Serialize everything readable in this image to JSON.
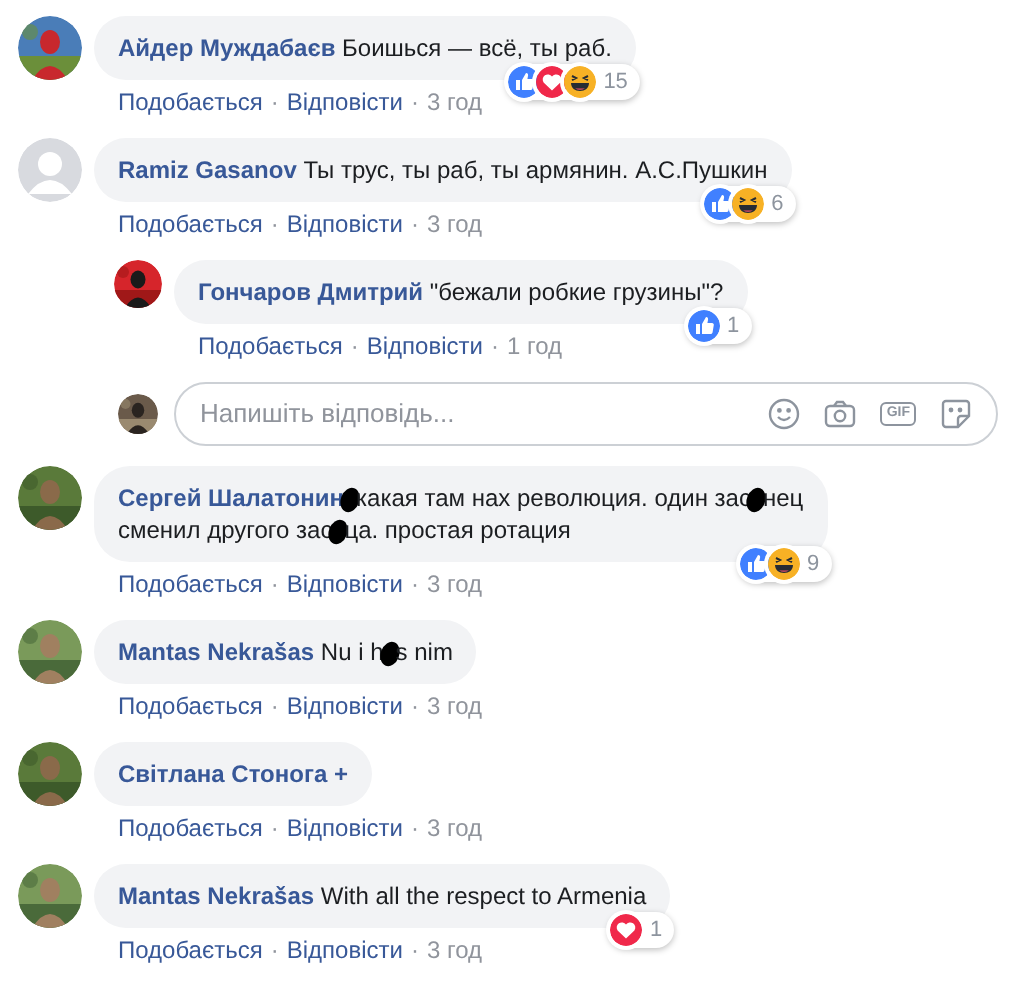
{
  "comments": [
    {
      "avatar": {
        "kind": "sos"
      },
      "name": "Айдер Муждабаєв",
      "parts": [
        {
          "kind": "text",
          "text": "Боишься — всё, ты раб."
        }
      ],
      "reactions": [
        {
          "kind": "like"
        },
        {
          "kind": "love"
        },
        {
          "kind": "haha"
        }
      ],
      "count": "15",
      "actions": [
        {
          "kind": "link",
          "text": "Подобається"
        },
        {
          "kind": "dot",
          "text": "·"
        },
        {
          "kind": "link",
          "text": "Відповісти"
        },
        {
          "kind": "dot",
          "text": "·"
        },
        {
          "kind": "time",
          "text": "3 год"
        }
      ]
    },
    {
      "avatar": {
        "kind": "default"
      },
      "name": "Ramiz Gasanov",
      "parts": [
        {
          "kind": "text",
          "text": "Ты трус, ты раб, ты армянин. А.С.Пушкин"
        }
      ],
      "reactions": [
        {
          "kind": "like"
        },
        {
          "kind": "haha"
        }
      ],
      "count": "6",
      "actions": [
        {
          "kind": "link",
          "text": "Подобається"
        },
        {
          "kind": "dot",
          "text": "·"
        },
        {
          "kind": "link",
          "text": "Відповісти"
        },
        {
          "kind": "dot",
          "text": "·"
        },
        {
          "kind": "time",
          "text": "3 год"
        }
      ],
      "children": [
        {
          "avatar": {
            "kind": "red"
          },
          "name": "Гончаров Дмитрий",
          "parts": [
            {
              "kind": "text",
              "text": "\"бежали робкие грузины\"?"
            }
          ],
          "reactions": [
            {
              "kind": "like"
            }
          ],
          "count": "1",
          "actions": [
            {
              "kind": "link",
              "text": "Подобається"
            },
            {
              "kind": "dot",
              "text": "·"
            },
            {
              "kind": "link",
              "text": "Відповісти"
            },
            {
              "kind": "dot",
              "text": "·"
            },
            {
              "kind": "time",
              "text": "1 год"
            }
          ]
        }
      ],
      "reply_box": {
        "avatar": {
          "kind": "dark"
        },
        "placeholder": "Напишіть відповідь...",
        "gif_label": "GIF"
      }
    },
    {
      "avatar": {
        "kind": "forest"
      },
      "name": "Сергей Шалатонин",
      "parts": [
        {
          "kind": "blot"
        },
        {
          "kind": "text",
          "text": "какая там нах революция. один зас"
        },
        {
          "kind": "blot"
        },
        {
          "kind": "text",
          "text": "нец"
        },
        {
          "kind": "break"
        },
        {
          "kind": "text",
          "text": "сменил другого зас"
        },
        {
          "kind": "blot"
        },
        {
          "kind": "text",
          "text": "ца. простая ротация"
        }
      ],
      "reactions": [
        {
          "kind": "like"
        },
        {
          "kind": "haha"
        }
      ],
      "count": "9",
      "actions": [
        {
          "kind": "link",
          "text": "Подобається"
        },
        {
          "kind": "dot",
          "text": "·"
        },
        {
          "kind": "link",
          "text": "Відповісти"
        },
        {
          "kind": "dot",
          "text": "·"
        },
        {
          "kind": "time",
          "text": "3 год"
        }
      ]
    },
    {
      "avatar": {
        "kind": "park"
      },
      "name": "Mantas Nekrašas",
      "parts": [
        {
          "kind": "text",
          "text": "Nu i h"
        },
        {
          "kind": "blot"
        },
        {
          "kind": "text",
          "text": "s nim"
        }
      ],
      "actions": [
        {
          "kind": "link",
          "text": "Подобається"
        },
        {
          "kind": "dot",
          "text": "·"
        },
        {
          "kind": "link",
          "text": "Відповісти"
        },
        {
          "kind": "dot",
          "text": "·"
        },
        {
          "kind": "time",
          "text": "3 год"
        }
      ]
    },
    {
      "avatar": {
        "kind": "forest"
      },
      "name": "Світлана Стонога +",
      "actions": [
        {
          "kind": "link",
          "text": "Подобається"
        },
        {
          "kind": "dot",
          "text": "·"
        },
        {
          "kind": "link",
          "text": "Відповісти"
        },
        {
          "kind": "dot",
          "text": "·"
        },
        {
          "kind": "time",
          "text": "3 год"
        }
      ]
    },
    {
      "avatar": {
        "kind": "park"
      },
      "name": "Mantas Nekrašas",
      "parts": [
        {
          "kind": "text",
          "text": "With all the respect to Armenia"
        }
      ],
      "reactions": [
        {
          "kind": "love"
        }
      ],
      "count": "1",
      "actions": [
        {
          "kind": "link",
          "text": "Подобається"
        },
        {
          "kind": "dot",
          "text": "·"
        },
        {
          "kind": "link",
          "text": "Відповісти"
        },
        {
          "kind": "dot",
          "text": "·"
        },
        {
          "kind": "time",
          "text": "3 год"
        }
      ]
    }
  ]
}
